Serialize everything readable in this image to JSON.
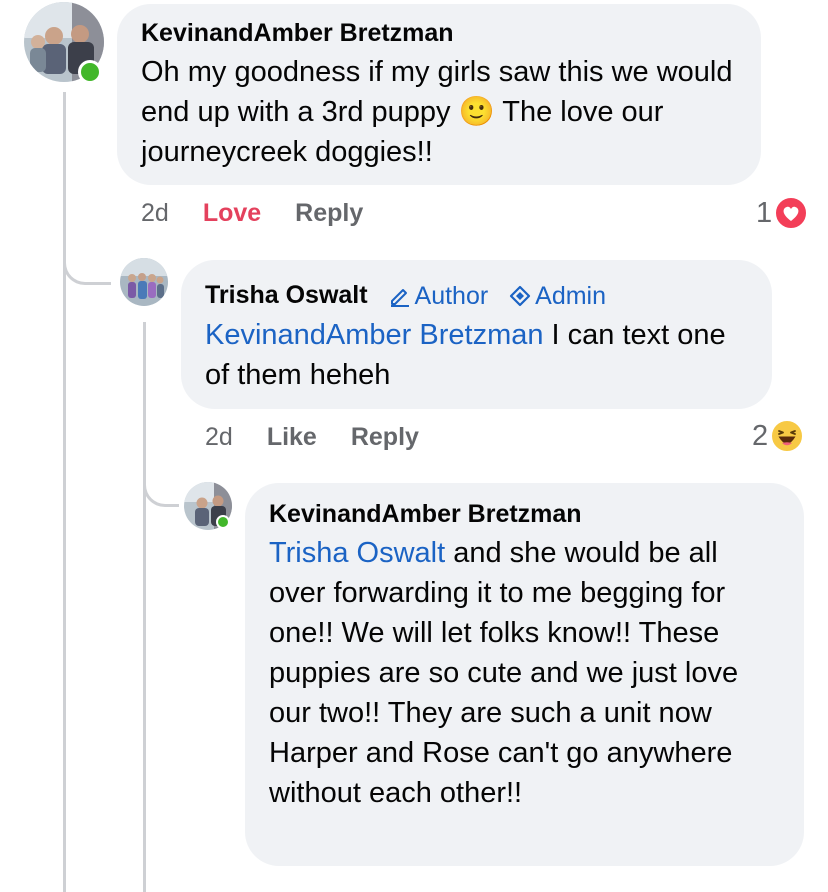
{
  "comments": [
    {
      "author": "KevinandAmber Bretzman",
      "text": "Oh my goodness if my girls saw this we would end up with a 3rd puppy 🙂 The love our journeycreek doggies!!",
      "time": "2d",
      "reaction_action": "Love",
      "reply_label": "Reply",
      "reaction_count": "1",
      "reaction_type": "love",
      "online": true
    },
    {
      "author": "Trisha Oswalt",
      "badges": [
        "Author",
        "Admin"
      ],
      "mention": "KevinandAmber Bretzman",
      "text": " I can text one of them heheh",
      "time": "2d",
      "reaction_action": "Like",
      "reply_label": "Reply",
      "reaction_count": "2",
      "reaction_type": "haha"
    },
    {
      "author": "KevinandAmber Bretzman",
      "mention": "Trisha Oswalt",
      "text": " and she would be all over forwarding it to me begging for one!! We will let folks know!! These puppies are so cute and we just love our two!! They are such a unit now Harper and Rose can't go anywhere without each other!!",
      "online": true
    }
  ],
  "colors": {
    "mention": "#1b63c4",
    "love": "#e4415d",
    "meta": "#65676b",
    "bubble": "#f0f2f5",
    "online": "#42b72a",
    "thread_line": "#ced0d4"
  }
}
